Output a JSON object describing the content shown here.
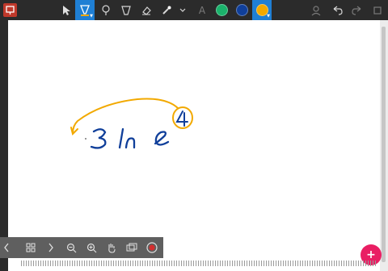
{
  "toolbar": {
    "tools": [
      {
        "name": "app-icon"
      },
      {
        "name": "select-arrow-icon"
      },
      {
        "name": "pen-icon",
        "selected": true
      },
      {
        "name": "highlighter-icon"
      },
      {
        "name": "marker-icon"
      },
      {
        "name": "eraser-icon"
      },
      {
        "name": "laser-pointer-icon"
      },
      {
        "name": "more-chevron-icon"
      },
      {
        "name": "text-icon",
        "label": "A"
      }
    ],
    "colors": [
      "#1bb36c",
      "#103f9a",
      "#f2a900"
    ],
    "selected_color": "#f2a900",
    "right_icons": [
      "add-user-icon",
      "undo-icon",
      "redo-icon",
      "shape-icon"
    ]
  },
  "canvas": {
    "ink_text": "3 ln e",
    "circled_exponent": "4",
    "ink_blue": "#103f9a",
    "ink_yellow": "#f2a900"
  },
  "navbar": {
    "items": [
      "prev-icon",
      "grid-icon",
      "next-icon",
      "zoom-out-icon",
      "zoom-in-icon",
      "hand-icon",
      "fit-page-icon",
      "record-icon"
    ]
  },
  "fab": {
    "label": "+"
  }
}
